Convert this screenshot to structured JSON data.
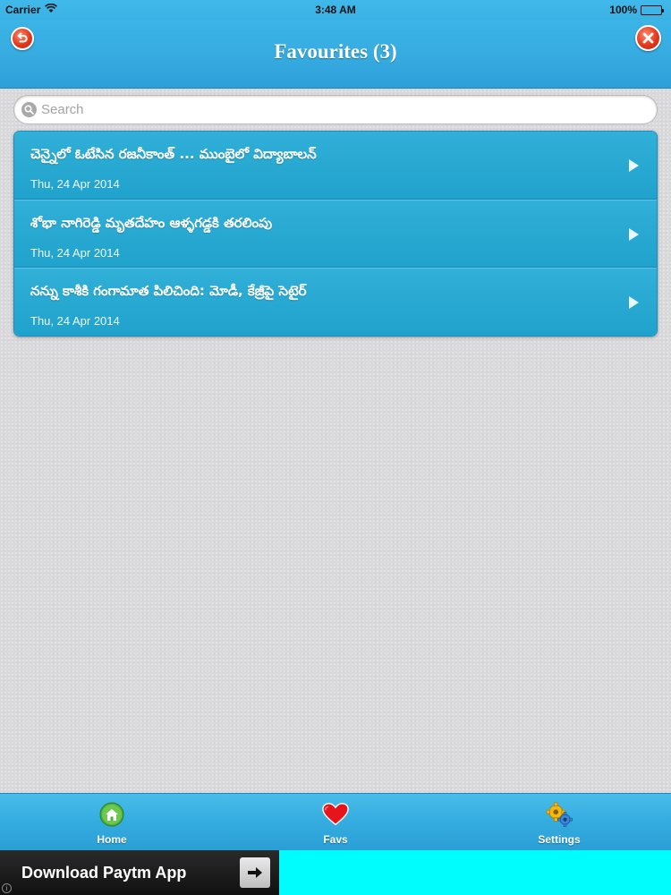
{
  "status_bar": {
    "carrier": "Carrier",
    "time": "3:48 AM",
    "battery": "100%",
    "battery_level": 1.0
  },
  "nav": {
    "title": "Favourites (3)",
    "back_icon": "undo-icon",
    "close_icon": "close-icon"
  },
  "search": {
    "placeholder": "Search",
    "value": ""
  },
  "favourites": [
    {
      "title": "చెన్నైలో ఓటేసిన రజనీకాంత్ ... ముంబైలో విద్యాబాలన్",
      "date": "Thu, 24 Apr 2014"
    },
    {
      "title": "శోభా నాగిరెడ్డి మృతదేహం ఆళ్ళగడ్డకి తరలింపు",
      "date": "Thu, 24 Apr 2014"
    },
    {
      "title": "నన్ను కాశీకి గంగామాత పిలిచింది: మోడీ, కేజ్రీపై సెటైర్",
      "date": "Thu, 24 Apr 2014"
    }
  ],
  "tabs": [
    {
      "label": "Home",
      "icon": "home-icon"
    },
    {
      "label": "Favs",
      "icon": "heart-icon"
    },
    {
      "label": "Settings",
      "icon": "gears-icon"
    }
  ],
  "ad": {
    "text": "Download Paytm App",
    "arrow_icon": "arrow-right-icon",
    "info_icon": "info-icon"
  },
  "colors": {
    "accent": "#35aae0",
    "list_item": "#22a4ce",
    "button_red": "#e2381c",
    "ad_background": "#00fdfd"
  }
}
